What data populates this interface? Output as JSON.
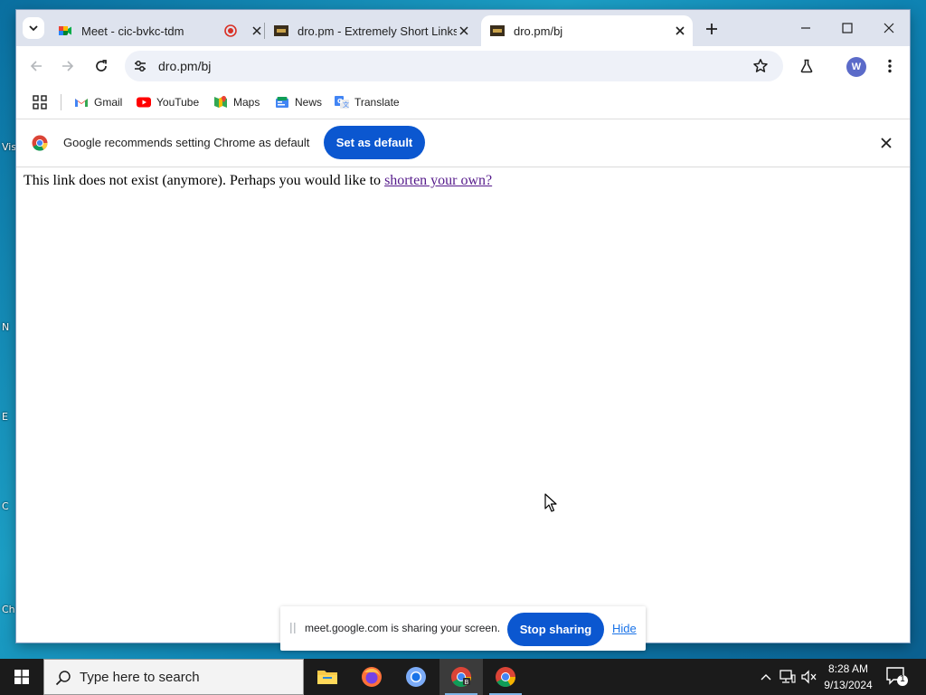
{
  "desktop": {
    "icon_fragments": [
      "Vis",
      "N",
      "E",
      "C",
      "Ch"
    ]
  },
  "tabs": [
    {
      "title": "Meet - cic-bvkc-tdm",
      "favicon": "google-meet-icon",
      "recording": true
    },
    {
      "title": "dro.pm - Extremely Short Links",
      "favicon": "dro-pm-icon"
    },
    {
      "title": "dro.pm/bj",
      "favicon": "dro-pm-icon",
      "active": true
    }
  ],
  "address_bar": {
    "url": "dro.pm/bj"
  },
  "profile": {
    "initial": "W",
    "color": "#5b6bc9"
  },
  "bookmarks": [
    {
      "label": "Gmail",
      "icon": "gmail-icon"
    },
    {
      "label": "YouTube",
      "icon": "youtube-icon"
    },
    {
      "label": "Maps",
      "icon": "maps-icon"
    },
    {
      "label": "News",
      "icon": "news-icon"
    },
    {
      "label": "Translate",
      "icon": "translate-icon"
    }
  ],
  "infobar": {
    "message": "Google recommends setting Chrome as default",
    "button": "Set as default"
  },
  "page": {
    "message_prefix": "This link does not exist (anymore). Perhaps you would like to ",
    "link_text": "shorten your own?"
  },
  "screen_share": {
    "message": "meet.google.com is sharing your screen.",
    "stop_button": "Stop sharing",
    "hide_link": "Hide"
  },
  "taskbar": {
    "search_placeholder": "Type here to search",
    "apps": [
      "file-explorer-icon",
      "firefox-icon",
      "chromium-icon",
      "chrome-canary-icon",
      "chrome-icon"
    ],
    "time": "8:28 AM",
    "date": "9/13/2024",
    "notification_count": "1"
  },
  "colors": {
    "accent": "#0b57d0",
    "tab_strip": "#dee3ee",
    "omnibox": "#eef1f8"
  }
}
